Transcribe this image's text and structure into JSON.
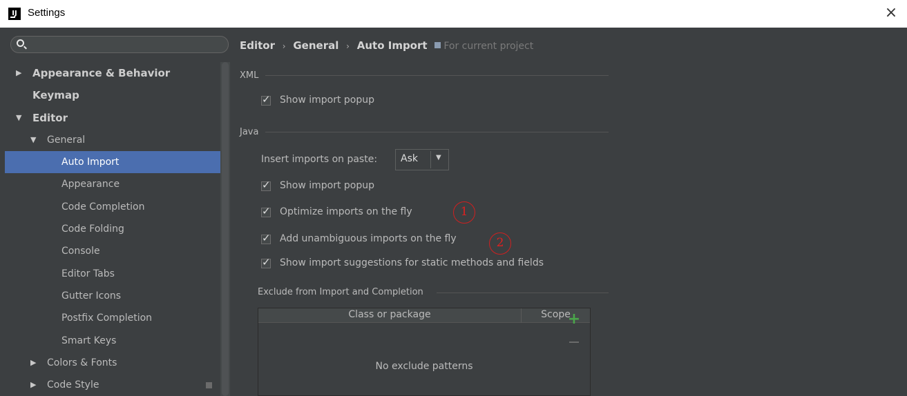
{
  "window": {
    "title": "Settings",
    "app_icon": "IJ",
    "close_glyph": "×"
  },
  "sidebar": {
    "search": {
      "value": "",
      "placeholder": ""
    },
    "items": [
      {
        "label": "Appearance & Behavior",
        "arrow": "▶",
        "level": 0,
        "bold": true
      },
      {
        "label": "Keymap",
        "arrow": "",
        "level": 0,
        "bold": true
      },
      {
        "label": "Editor",
        "arrow": "▼",
        "level": 0,
        "bold": true
      },
      {
        "label": "General",
        "arrow": "▼",
        "level": 1
      },
      {
        "label": "Auto Import",
        "level": 2,
        "selected": true
      },
      {
        "label": "Appearance",
        "level": 2
      },
      {
        "label": "Code Completion",
        "level": 2
      },
      {
        "label": "Code Folding",
        "level": 2
      },
      {
        "label": "Console",
        "level": 2
      },
      {
        "label": "Editor Tabs",
        "level": 2
      },
      {
        "label": "Gutter Icons",
        "level": 2
      },
      {
        "label": "Postfix Completion",
        "level": 2
      },
      {
        "label": "Smart Keys",
        "level": 2
      },
      {
        "label": "Colors & Fonts",
        "arrow": "▶",
        "level": 1
      },
      {
        "label": "Code Style",
        "arrow": "▶",
        "level": 1,
        "project_icon": true
      }
    ]
  },
  "main": {
    "breadcrumb": {
      "parts": [
        "Editor",
        "General",
        "Auto Import"
      ],
      "separator": "›",
      "project_note": "For current project"
    },
    "xml": {
      "title": "XML",
      "show_import_popup": {
        "label": "Show import popup",
        "checked": true
      }
    },
    "java": {
      "title": "Java",
      "insert_imports_label": "Insert imports on paste:",
      "insert_imports_value": "Ask",
      "combo_arrow": "▼",
      "options": [
        {
          "label": "Show import popup",
          "checked": true
        },
        {
          "label": "Optimize imports on the fly",
          "checked": true
        },
        {
          "label": "Add unambiguous imports on the fly",
          "checked": true
        },
        {
          "label": "Show import suggestions for static methods and fields",
          "checked": true
        }
      ]
    },
    "annotations": [
      "1",
      "2"
    ],
    "exclude": {
      "title": "Exclude from Import and Completion",
      "columns": [
        "Class or package",
        "Scope"
      ],
      "empty_text": "No exclude patterns",
      "add_glyph": "+"
    }
  },
  "colors": {
    "background": "#3c3f41",
    "selection": "#4b6eaf",
    "annotation_red": "#d02020",
    "add_green": "#4aa64a"
  }
}
